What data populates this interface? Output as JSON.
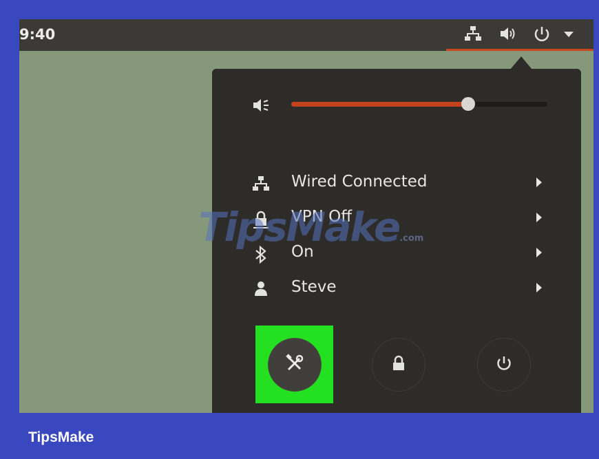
{
  "topbar": {
    "clock": "9:40",
    "icons": [
      "network-icon",
      "speaker-icon",
      "power-icon",
      "dropdown-arrow-icon"
    ],
    "accent_color": "#c9481e"
  },
  "menu": {
    "volume": {
      "icon": "volume-low-icon",
      "level": 0.69
    },
    "items": [
      {
        "icon": "network-icon",
        "label": "Wired Connected"
      },
      {
        "icon": "lock-icon",
        "label": "VPN Off"
      },
      {
        "icon": "bluetooth-icon",
        "label": "On"
      },
      {
        "icon": "user-icon",
        "label": "Steve"
      }
    ],
    "buttons": [
      {
        "icon": "settings-tools-icon",
        "highlighted": true
      },
      {
        "icon": "lock-icon",
        "highlighted": false
      },
      {
        "icon": "power-icon",
        "highlighted": false
      }
    ]
  },
  "watermark": {
    "text": "TipsMake",
    "suffix": ".com"
  },
  "footer": {
    "brand": "TipsMake",
    "background": "#3a48c0"
  }
}
